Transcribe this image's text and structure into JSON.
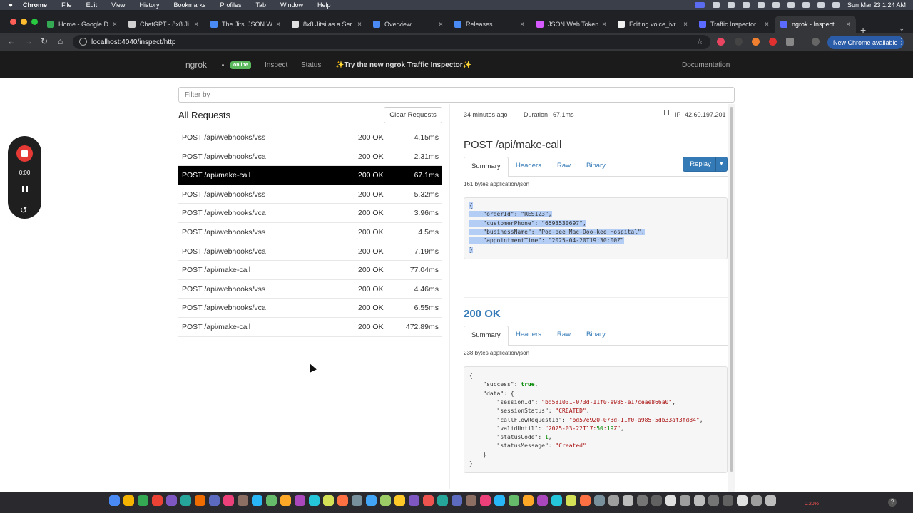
{
  "menubar": {
    "app": "Chrome",
    "items": [
      "File",
      "Edit",
      "View",
      "History",
      "Bookmarks",
      "Profiles",
      "Tab",
      "Window",
      "Help"
    ],
    "clock": "Sun Mar 23  1:24 AM"
  },
  "tabs": [
    {
      "label": "Home - Google D",
      "color": "#34a853"
    },
    {
      "label": "ChatGPT - 8x8 Ji",
      "color": "#d0d0d0"
    },
    {
      "label": "The Jitsi JSON W",
      "color": "#4a8af4"
    },
    {
      "label": "8x8 Jitsi as a Ser",
      "color": "#e0e0e0"
    },
    {
      "label": "Overview",
      "color": "#4a8af4"
    },
    {
      "label": "Releases",
      "color": "#4a8af4"
    },
    {
      "label": "JSON Web Token",
      "color": "#d65aff"
    },
    {
      "label": "Editing voice_ivr",
      "color": "#f0f0f0"
    },
    {
      "label": "Traffic Inspector",
      "color": "#5c6bff"
    },
    {
      "label": "ngrok - Inspect",
      "color": "#5c6bff"
    }
  ],
  "browser": {
    "url": "localhost:4040/inspect/http",
    "update_label": "New Chrome available"
  },
  "navbar": {
    "brand": "ngrok",
    "status": "online",
    "links": [
      "Inspect",
      "Status"
    ],
    "promo": "✨Try the new ngrok Traffic Inspector✨",
    "docs": "Documentation"
  },
  "filter": {
    "placeholder": "Filter by"
  },
  "requests": {
    "title": "All Requests",
    "clear_label": "Clear Requests",
    "selected_index": 2,
    "rows": [
      {
        "path": "POST /api/webhooks/vss",
        "status": "200 OK",
        "duration": "4.15ms"
      },
      {
        "path": "POST /api/webhooks/vca",
        "status": "200 OK",
        "duration": "2.31ms"
      },
      {
        "path": "POST /api/make-call",
        "status": "200 OK",
        "duration": "67.1ms"
      },
      {
        "path": "POST /api/webhooks/vss",
        "status": "200 OK",
        "duration": "5.32ms"
      },
      {
        "path": "POST /api/webhooks/vca",
        "status": "200 OK",
        "duration": "3.96ms"
      },
      {
        "path": "POST /api/webhooks/vss",
        "status": "200 OK",
        "duration": "4.5ms"
      },
      {
        "path": "POST /api/webhooks/vca",
        "status": "200 OK",
        "duration": "7.19ms"
      },
      {
        "path": "POST /api/make-call",
        "status": "200 OK",
        "duration": "77.04ms"
      },
      {
        "path": "POST /api/webhooks/vss",
        "status": "200 OK",
        "duration": "4.46ms"
      },
      {
        "path": "POST /api/webhooks/vca",
        "status": "200 OK",
        "duration": "6.55ms"
      },
      {
        "path": "POST /api/make-call",
        "status": "200 OK",
        "duration": "472.89ms"
      }
    ]
  },
  "detail": {
    "time_ago": "34 minutes ago",
    "duration_label": "Duration",
    "duration": "67.1ms",
    "ip_label": "IP",
    "ip": "42.60.197.201",
    "request_title": "POST /api/make-call",
    "request_tabs": [
      "Summary",
      "Headers",
      "Raw",
      "Binary"
    ],
    "replay_label": "Replay",
    "request_body_info": "161 bytes application/json",
    "request_lines": [
      "{",
      "    \"orderId\": \"RES123\",",
      "    \"customerPhone\": \"6593530697\",",
      "    \"businessName\": \"Poo-pee Mac-Doo-kee Hospital\",",
      "    \"appointmentTime\": \"2025-04-20T19:30:00Z\"",
      "}"
    ],
    "response_status": "200 OK",
    "response_tabs": [
      "Summary",
      "Headers",
      "Raw",
      "Binary"
    ],
    "response_body_info": "238 bytes application/json",
    "response_lines": [
      "{",
      "    \"success\": true,",
      "    \"data\": {",
      "        \"sessionId\": \"bd581031-073d-11f0-a985-e17ceae866a0\",",
      "        \"sessionStatus\": \"CREATED\",",
      "        \"callFlowRequestId\": \"bd57e920-073d-11f0-a985-5db33af3fd84\",",
      "        \"validUntil\": \"2025-03-22T17:50:19Z\",",
      "        \"statusCode\": 1,",
      "        \"statusMessage\": \"Created\"",
      "    }",
      "}"
    ]
  },
  "recorder": {
    "time": "0:00"
  },
  "dock": {
    "zoom": "0.20%"
  }
}
